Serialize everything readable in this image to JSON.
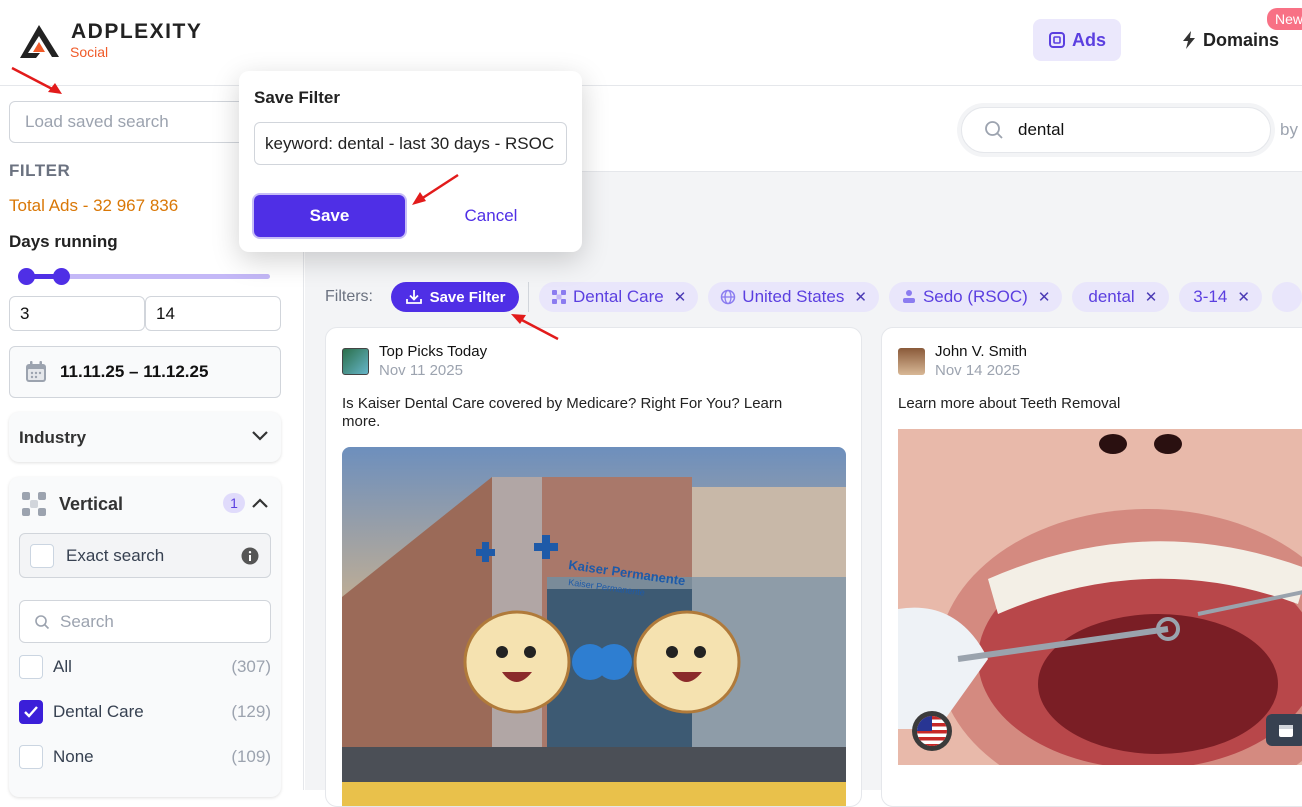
{
  "header": {
    "logo_name": "ADPLEXITY",
    "logo_sub": "Social",
    "nav": {
      "ads_label": "Ads",
      "domains_label": "Domains",
      "new_badge": "New"
    },
    "accent": "#5b3fe0"
  },
  "sidebar": {
    "saved_search_placeholder": "Load saved search",
    "filter_heading": "FILTER",
    "total_ads": "Total Ads - 32 967 836",
    "days_running_label": "Days running",
    "days_min": "3",
    "days_max": "14",
    "date_range": "11.11.25 – 11.12.25",
    "industry_label": "Industry",
    "vertical": {
      "label": "Vertical",
      "count_badge": "1",
      "exact_search_label": "Exact search",
      "search_placeholder": "Search",
      "options": [
        {
          "label": "All",
          "count": "(307)",
          "checked": false
        },
        {
          "label": "Dental Care",
          "count": "(129)",
          "checked": true
        },
        {
          "label": "None",
          "count": "(109)",
          "checked": false
        }
      ]
    }
  },
  "main": {
    "search_value": "dental",
    "search_suffix": "by",
    "filters_label": "Filters:",
    "save_filter_button": "Save Filter",
    "chips": [
      {
        "label": "Dental Care",
        "icon": "vertical-icon"
      },
      {
        "label": "United States",
        "icon": "globe-icon"
      },
      {
        "label": "Sedo (RSOC)",
        "icon": "network-icon"
      },
      {
        "label": "dental",
        "icon": ""
      },
      {
        "label": "3-14",
        "icon": ""
      }
    ],
    "cards": [
      {
        "name": "Top Picks Today",
        "date": "Nov 11 2025",
        "text": "Is Kaiser Dental Care covered by Medicare? Right For You? Learn more.",
        "building_sign_1": "Kaiser Permanente",
        "building_sign_2": "Kaiser Permanente"
      },
      {
        "name": "John V. Smith",
        "date": "Nov 14 2025",
        "text": "Learn more about Teeth Removal"
      }
    ]
  },
  "modal": {
    "title": "Save Filter",
    "input_value": "keyword: dental - last 30 days - RSOC",
    "save_label": "Save",
    "cancel_label": "Cancel"
  }
}
